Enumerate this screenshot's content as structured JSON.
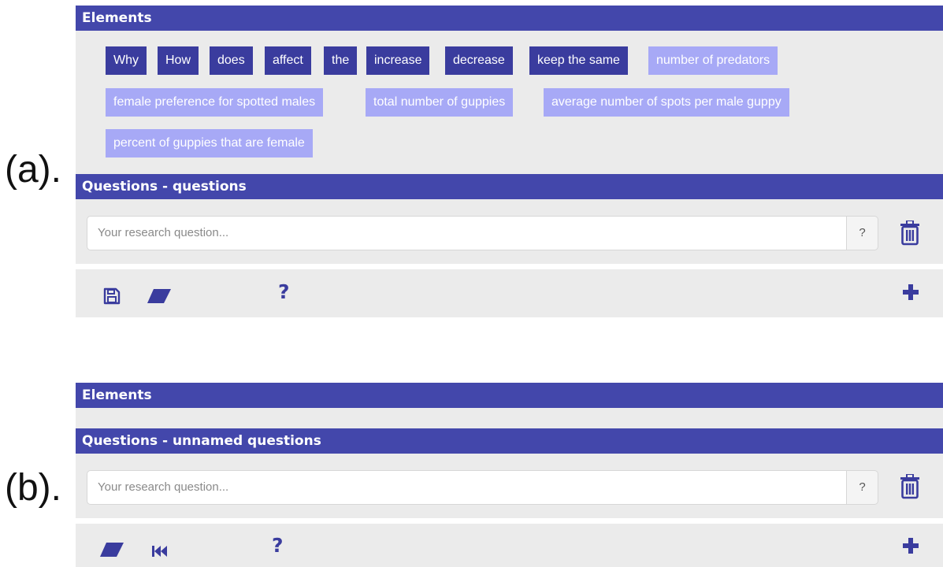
{
  "panel_a": {
    "label": "(a).",
    "elements_header": "Elements",
    "tags": [
      {
        "text": "Why",
        "style": "dark"
      },
      {
        "text": "How",
        "style": "dark"
      },
      {
        "text": "does",
        "style": "dark"
      },
      {
        "text": "affect",
        "style": "dark"
      },
      {
        "text": "the",
        "style": "dark"
      },
      {
        "text": "increase",
        "style": "dark"
      },
      {
        "text": "decrease",
        "style": "dark"
      },
      {
        "text": "keep the same",
        "style": "dark"
      },
      {
        "text": "number of predators",
        "style": "light"
      },
      {
        "text": "female preference for spotted males",
        "style": "light"
      },
      {
        "text": "total number of guppies",
        "style": "light"
      },
      {
        "text": "average number of spots per male guppy",
        "style": "light"
      },
      {
        "text": "percent of guppies that are female",
        "style": "light"
      }
    ],
    "questions_header": "Questions - questions",
    "input_placeholder": "Your research question...",
    "input_help": "?",
    "toolbar_help": "?"
  },
  "panel_b": {
    "label": "(b).",
    "elements_header": "Elements",
    "questions_header": "Questions - unnamed questions",
    "input_placeholder": "Your research question...",
    "input_help": "?",
    "toolbar_help": "?"
  },
  "colors": {
    "header": "#4347ab",
    "tag_dark": "#3a3c9e",
    "tag_light": "#a7a9f6",
    "panel_bg": "#ebebeb"
  },
  "icons": [
    "save-icon",
    "eraser-icon",
    "help-icon",
    "plus-icon",
    "trash-icon",
    "skip-back-icon"
  ]
}
